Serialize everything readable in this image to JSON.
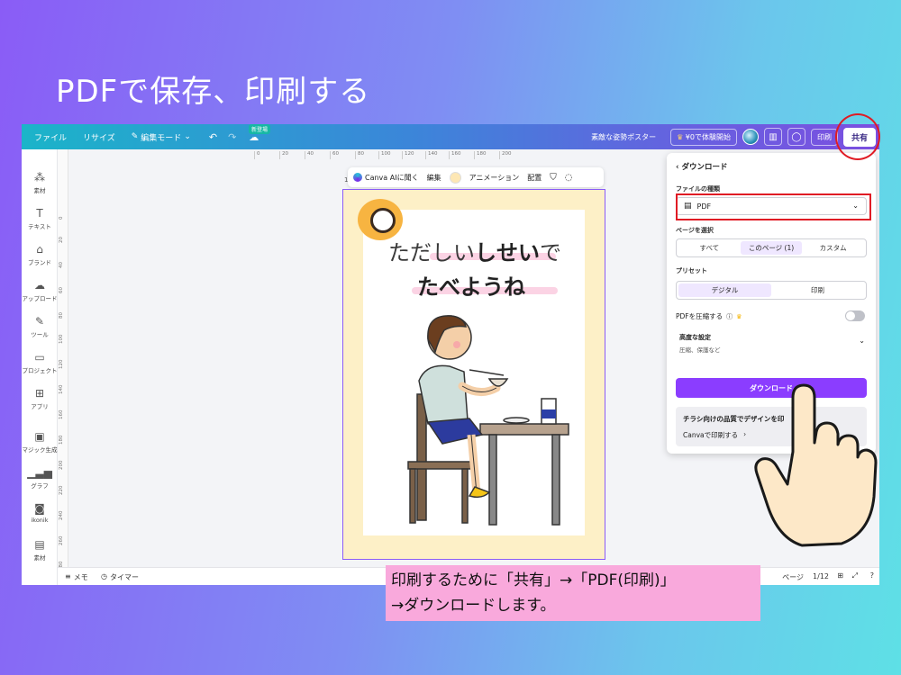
{
  "slide": {
    "title": "PDFで保存、印刷する",
    "caption_line1": "印刷するために「共有」→「PDF(印刷)」",
    "caption_line2": "→ダウンロードします。"
  },
  "topbar": {
    "file": "ファイル",
    "resize": "リサイズ",
    "edit_mode": "編集モード",
    "new_badge": "新登場",
    "doc_title": "素敵な姿勢ポスター",
    "trial": "¥0で体験開始",
    "print": "印刷",
    "share": "共有",
    "accent_color": "#8b3dff"
  },
  "sidebar": {
    "items": [
      {
        "label": "素材",
        "icon": "elements-icon"
      },
      {
        "label": "テキスト",
        "icon": "text-icon"
      },
      {
        "label": "ブランド",
        "icon": "brand-icon"
      },
      {
        "label": "アップロード",
        "icon": "upload-icon"
      },
      {
        "label": "ツール",
        "icon": "tools-icon"
      },
      {
        "label": "プロジェクト",
        "icon": "folder-icon"
      },
      {
        "label": "アプリ",
        "icon": "apps-icon"
      },
      {
        "label": "マジック生成",
        "icon": "magic-icon"
      },
      {
        "label": "グラフ",
        "icon": "chart-icon"
      },
      {
        "label": "ikonik",
        "icon": "ikonik-icon"
      },
      {
        "label": "素材",
        "icon": "elements-icon"
      }
    ]
  },
  "rulers": {
    "horizontal": [
      "0",
      "20",
      "40",
      "60",
      "80",
      "100",
      "120",
      "140",
      "160",
      "180",
      "200"
    ],
    "vertical": [
      "0",
      "20",
      "40",
      "60",
      "80",
      "100",
      "120",
      "140",
      "160",
      "180",
      "200",
      "220",
      "240",
      "260",
      "280"
    ]
  },
  "floatbar": {
    "ask_ai": "Canva AIに聞く",
    "edit": "編集",
    "animation": "アニメーション",
    "arrange": "配置"
  },
  "poster": {
    "line1_plain": "ただしい",
    "line1_bold": "しせい",
    "line1_end": "で",
    "line2": "たべようね",
    "page_number": "1"
  },
  "download_panel": {
    "back_label": "ダウンロード",
    "file_type_label": "ファイルの種類",
    "file_type_value": "PDF",
    "page_select_label": "ページを選択",
    "page_options": [
      "すべて",
      "このページ (1)",
      "カスタム"
    ],
    "preset_label": "プリセット",
    "preset_options": [
      "デジタル",
      "印刷"
    ],
    "compress_label": "PDFを圧縮する",
    "advanced_label": "高度な設定",
    "advanced_sub": "圧縮、保護など",
    "download_button": "ダウンロード",
    "print_card_title": "チラシ向けの品質でデザインを印",
    "print_card_link": "Canvaで印刷する"
  },
  "bottombar": {
    "memo": "メモ",
    "timer": "タイマー",
    "pages": "ページ",
    "page_count": "1/12"
  }
}
